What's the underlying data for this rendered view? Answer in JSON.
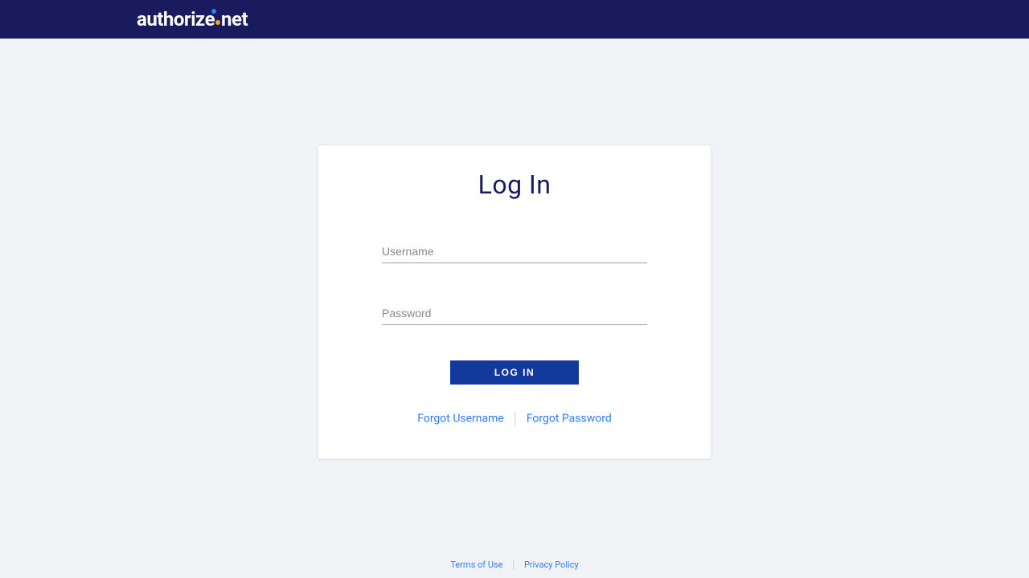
{
  "header": {
    "brand_part1": "author",
    "brand_part2": "ze",
    "brand_part3": "net"
  },
  "card": {
    "title": "Log In",
    "username_placeholder": "Username",
    "password_placeholder": "Password",
    "login_button": "LOG IN",
    "forgot_username": "Forgot Username",
    "forgot_password": "Forgot Password"
  },
  "footer": {
    "terms": "Terms of Use",
    "privacy": "Privacy Policy"
  }
}
